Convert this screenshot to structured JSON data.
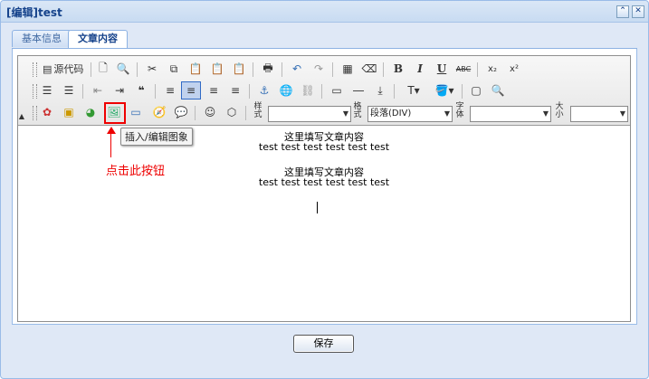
{
  "window": {
    "title": "[编辑]test",
    "restore_icon": "restore-icon",
    "close_icon": "close-icon"
  },
  "tabs": [
    {
      "label": "基本信息",
      "active": false
    },
    {
      "label": "文章内容",
      "active": true
    }
  ],
  "toolbar": {
    "source_label": "源代码",
    "row3_labels": {
      "style": [
        "样",
        "式"
      ],
      "format": [
        "格",
        "式"
      ],
      "font": [
        "字",
        "体"
      ],
      "size": [
        "大",
        "小"
      ]
    },
    "style_value": "",
    "format_value": "段落(DIV)",
    "font_value": "",
    "size_value": ""
  },
  "content": {
    "lines": [
      "这里填写文章内容",
      "test test test test test test",
      "这里填写文章内容",
      "test test test test test test"
    ]
  },
  "tooltip": "插入/编辑图象",
  "annotation": "点击此按钮",
  "save_label": "保存",
  "colors": {
    "annotation": "#e00000",
    "window_border": "#99bbe8",
    "title_text": "#15428b"
  }
}
